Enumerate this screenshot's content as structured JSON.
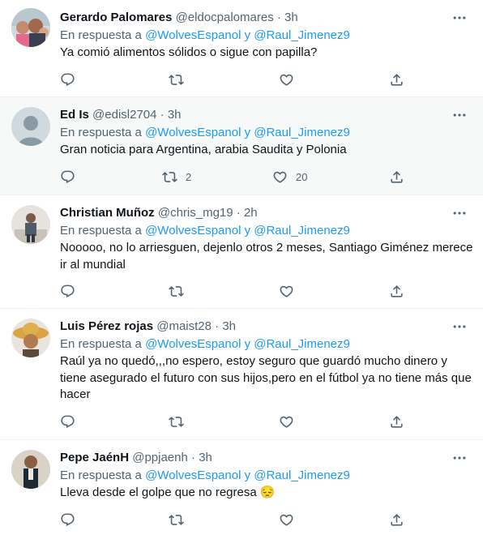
{
  "replying_prefix": "En respuesta a",
  "replying_to": "@WolvesEspanol y @Raul_Jimenez9",
  "dot": "·",
  "tweets": [
    {
      "name": "Gerardo Palomares",
      "handle": "@eldocpalomares",
      "time": "3h",
      "text": "Ya comió alimentos sólidos o sigue con papilla?",
      "reply_count": "",
      "retweet_count": "",
      "like_count": ""
    },
    {
      "name": "Ed Is",
      "handle": "@edisl2704",
      "time": "3h",
      "text": "Gran noticia para Argentina, arabia Saudita y Polonia",
      "reply_count": "",
      "retweet_count": "2",
      "like_count": "20"
    },
    {
      "name": "Christian Muñoz",
      "handle": "@chris_mg19",
      "time": "2h",
      "text": "Nooooo, no lo arriesguen, dejenlo otros 2 meses, Santiago Giménez merece ir al mundial",
      "reply_count": "",
      "retweet_count": "",
      "like_count": ""
    },
    {
      "name": "Luis Pérez rojas",
      "handle": "@maist28",
      "time": "3h",
      "text": "Raúl ya no quedó,,,no espero, estoy seguro que guardó mucho dinero y tiene asegurado el futuro con sus hijos,pero en el fútbol ya no tiene más que hacer",
      "reply_count": "",
      "retweet_count": "",
      "like_count": ""
    },
    {
      "name": "Pepe JaénH",
      "handle": "@ppjaenh",
      "time": "3h",
      "text": "Lleva desde el golpe que no regresa 😔",
      "reply_count": "",
      "retweet_count": "",
      "like_count": ""
    }
  ],
  "icons": {
    "reply": "reply-icon",
    "retweet": "retweet-icon",
    "like": "heart-icon",
    "share": "share-icon",
    "more": "more-icon"
  },
  "colors": {
    "link": "#1d9bf0",
    "secondary": "#536471",
    "text": "#0f1419",
    "highlight_bg": "#f7f9f9"
  }
}
